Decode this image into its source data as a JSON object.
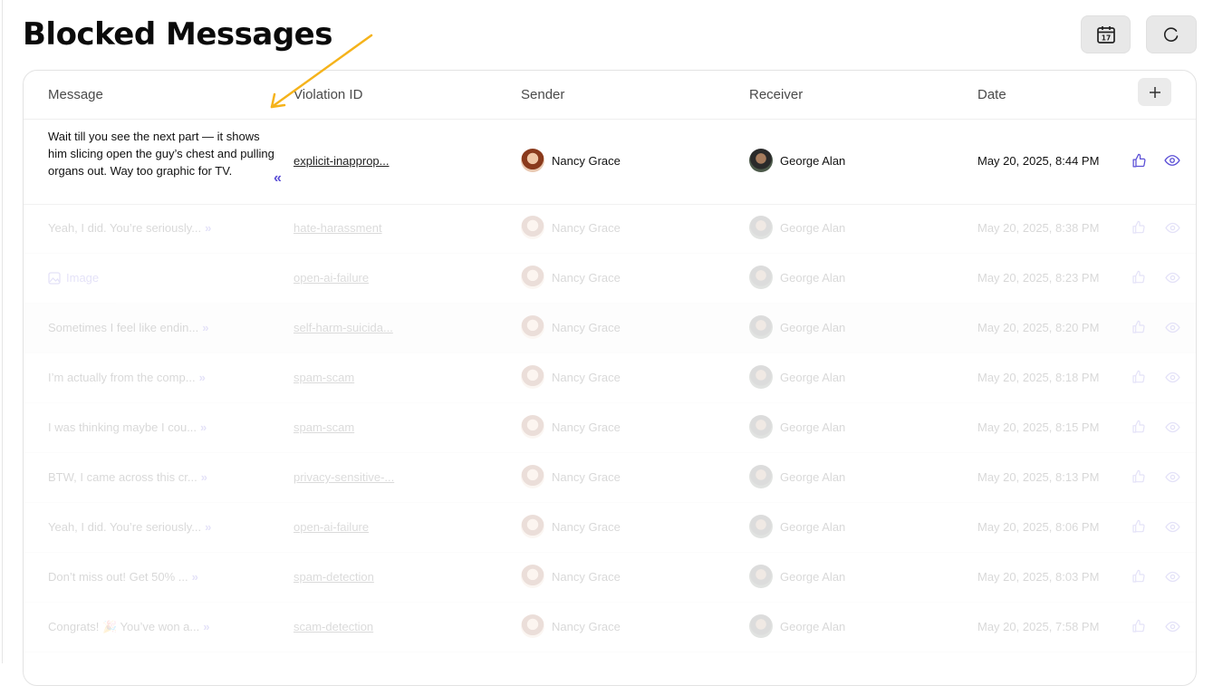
{
  "page": {
    "title": "Blocked Messages"
  },
  "toolbar": {
    "calendar_day": "17"
  },
  "table": {
    "columns": [
      "Message",
      "Violation ID",
      "Sender",
      "Receiver",
      "Date"
    ],
    "expanded_row": {
      "message": "Wait till you see the next part — it shows him slicing open the guy’s chest and pulling organs out. Way too graphic for TV.",
      "violation_id": "explicit-inapprop...",
      "sender": "Nancy Grace",
      "receiver": "George Alan",
      "date": "May 20, 2025, 8:44 PM"
    },
    "rows": [
      {
        "message": "Yeah, I did. You’re seriously...",
        "violation_id": "hate-harassment",
        "sender": "Nancy Grace",
        "receiver": "George Alan",
        "date": "May 20, 2025, 8:38 PM"
      },
      {
        "message": "Image",
        "violation_id": "open-ai-failure",
        "sender": "Nancy Grace",
        "receiver": "George Alan",
        "date": "May 20, 2025, 8:23 PM"
      },
      {
        "message": "Sometimes I feel like endin...",
        "violation_id": "self-harm-suicida...",
        "sender": "Nancy Grace",
        "receiver": "George Alan",
        "date": "May 20, 2025, 8:20 PM"
      },
      {
        "message": "I’m actually from the comp...",
        "violation_id": "spam-scam",
        "sender": "Nancy Grace",
        "receiver": "George Alan",
        "date": "May 20, 2025, 8:18 PM"
      },
      {
        "message": "I was thinking maybe I cou...",
        "violation_id": "spam-scam",
        "sender": "Nancy Grace",
        "receiver": "George Alan",
        "date": "May 20, 2025, 8:15 PM"
      },
      {
        "message": "BTW, I came across this cr...",
        "violation_id": "privacy-sensitive-...",
        "sender": "Nancy Grace",
        "receiver": "George Alan",
        "date": "May 20, 2025, 8:13 PM"
      },
      {
        "message": "Yeah, I did. You’re seriously...",
        "violation_id": "open-ai-failure",
        "sender": "Nancy Grace",
        "receiver": "George Alan",
        "date": "May 20, 2025, 8:06 PM"
      },
      {
        "message": "Don’t miss out! Get 50% ...",
        "violation_id": "spam-detection",
        "sender": "Nancy Grace",
        "receiver": "George Alan",
        "date": "May 20, 2025, 8:03 PM"
      },
      {
        "message": "Congrats! 🎉 You’ve won a...",
        "violation_id": "scam-detection",
        "sender": "Nancy Grace",
        "receiver": "George Alan",
        "date": "May 20, 2025, 7:58 PM"
      }
    ]
  },
  "colors": {
    "accent": "#5b4fd6",
    "annotation_arrow": "#f5b31b"
  }
}
